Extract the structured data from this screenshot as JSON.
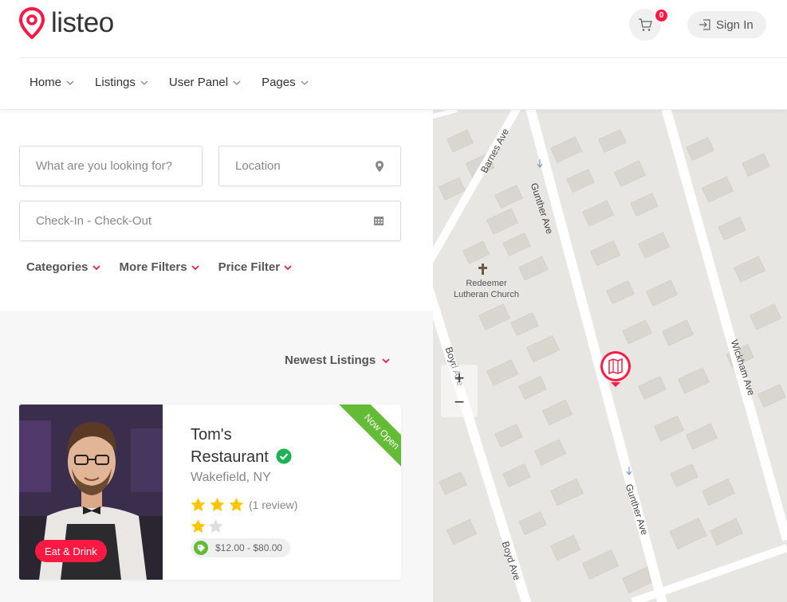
{
  "header": {
    "logo_text": "listeo",
    "cart_count": "0",
    "signin_label": "Sign In",
    "brand_color": "#f91942"
  },
  "nav": {
    "items": [
      {
        "label": "Home"
      },
      {
        "label": "Listings"
      },
      {
        "label": "User Panel"
      },
      {
        "label": "Pages"
      }
    ]
  },
  "search": {
    "keyword_placeholder": "What are you looking for?",
    "location_placeholder": "Location",
    "dates_placeholder": "Check-In - Check-Out"
  },
  "filters": {
    "items": [
      {
        "label": "Categories"
      },
      {
        "label": "More Filters"
      },
      {
        "label": "Price Filter"
      }
    ]
  },
  "sort": {
    "label": "Newest Listings"
  },
  "listing": {
    "title": "Tom's Restaurant",
    "location": "Wakefield, NY",
    "category": "Eat & Drink",
    "status": "Now Open",
    "review_text": "(1 review)",
    "price": "$12.00 - $80.00",
    "rating": 3.5,
    "accent_green": "#64bc36"
  },
  "map": {
    "streets": [
      "Barnes Ave",
      "Gunther Ave",
      "Gunther Ave",
      "Wickham Ave",
      "Boyd Ave",
      "Boyd Ave"
    ],
    "church_name": "Redeemer Lutheran Church",
    "zoom_in": "+",
    "zoom_out": "−"
  }
}
